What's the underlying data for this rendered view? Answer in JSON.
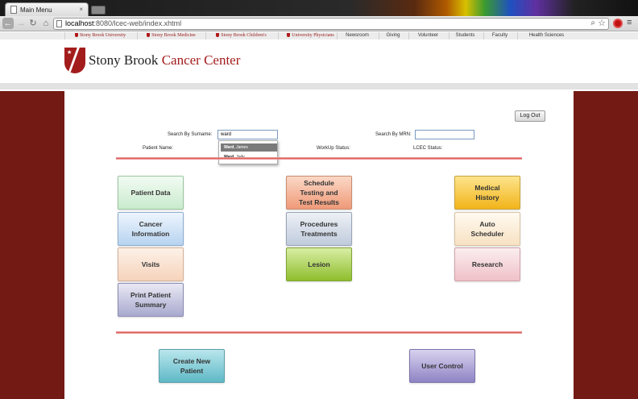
{
  "browser": {
    "tab_title": "Main Menu",
    "tab_close": "×",
    "url_host": "localhost",
    "url_path": ":8080/lcec-web/index.xhtml"
  },
  "linkbar": {
    "items": [
      {
        "label": "Stony Brook University",
        "brand": true
      },
      {
        "label": "Stony Brook Medicine",
        "brand": true
      },
      {
        "label": "Stony Brook Children's",
        "brand": true
      },
      {
        "label": "University Physicians",
        "brand": true
      },
      {
        "label": "Newsroom",
        "brand": false
      },
      {
        "label": "Giving",
        "brand": false
      },
      {
        "label": "Volunteer",
        "brand": false
      },
      {
        "label": "Students",
        "brand": false
      },
      {
        "label": "Faculty",
        "brand": false
      },
      {
        "label": "Health Sciences",
        "brand": false
      }
    ]
  },
  "logo": {
    "text_main": "Stony Brook ",
    "text_accent": "Cancer Center",
    "brand_color": "#a31c1c"
  },
  "header": {
    "logout_label": "Log Out"
  },
  "search": {
    "surname_label": "Search By Surname:",
    "surname_value": "ward",
    "mrn_label": "Search By MRN:",
    "mrn_value": "",
    "suggestions": [
      {
        "last": "Ward",
        "first": ", James",
        "selected": true
      },
      {
        "last": "Ward",
        "first": ", Judy",
        "selected": false
      }
    ]
  },
  "status": {
    "patient_name_label": "Patient Name:",
    "workup_label": "WorkUp Status:",
    "lcec_label": "LCEC Status:"
  },
  "tiles": [
    {
      "key": "patient_data",
      "label": "Patient Data"
    },
    {
      "key": "cancer_info",
      "label": "Cancer\nInformation"
    },
    {
      "key": "visits",
      "label": "Visits"
    },
    {
      "key": "print_summary",
      "label": "Print Patient\nSummary"
    },
    {
      "key": "schedule_testing",
      "label": "Schedule\nTesting and\nTest Results"
    },
    {
      "key": "procedures",
      "label": "Procedures\nTreatments"
    },
    {
      "key": "lesion",
      "label": "Lesion"
    },
    {
      "key": "medical_history",
      "label": "Medical\nHistory"
    },
    {
      "key": "auto_scheduler",
      "label": "Auto\nScheduler"
    },
    {
      "key": "research",
      "label": "Research"
    }
  ],
  "footer_buttons": {
    "create_patient": "Create New\nPatient",
    "user_control": "User Control"
  },
  "colors": {
    "side_panel": "#731a14",
    "accent_line": "#d9534f"
  }
}
